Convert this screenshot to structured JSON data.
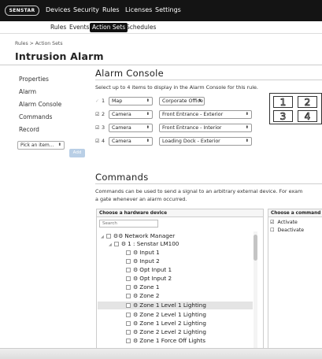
{
  "topnav": {
    "logo": "SENSTAR",
    "items": [
      "Devices",
      "Security",
      "Rules",
      "Licenses",
      "Settings"
    ]
  },
  "subnav": {
    "items": [
      "Rules",
      "Events",
      "Action Sets",
      "Schedules"
    ],
    "active": "Action Sets"
  },
  "header": {
    "breadcrumb": "Rules > Action Sets",
    "title": "Intrusion Alarm"
  },
  "sidebar": {
    "items": [
      "Properties",
      "Alarm",
      "Alarm Console",
      "Commands",
      "Record"
    ],
    "pick_select": "Pick an item...",
    "add_label": "Add"
  },
  "alarm_console": {
    "title": "Alarm Console",
    "description": "Select up to 4 items to display in the Alarm Console for this rule.",
    "slots": [
      {
        "num": "1",
        "checked": false,
        "type": "Map",
        "value": "Corporate Office"
      },
      {
        "num": "2",
        "checked": true,
        "type": "Camera",
        "value": "Front Entrance - Exterior"
      },
      {
        "num": "3",
        "checked": true,
        "type": "Camera",
        "value": "Front Entrance - Interior"
      },
      {
        "num": "4",
        "checked": true,
        "type": "Camera",
        "value": "Loading Dock - Exterior"
      }
    ],
    "grid_labels": [
      "1",
      "2",
      "3",
      "4"
    ]
  },
  "commands": {
    "title": "Commands",
    "description_line1": "Commands can be used to send a signal to an arbitrary external device. For exam",
    "description_line2": "a gate whenever an alarm occurred.",
    "hardware_panel_title": "Choose a hardware device",
    "search_placeholder": "Search",
    "tree": [
      {
        "label": "Network Manager",
        "level": 0,
        "gear": "double"
      },
      {
        "label": "1 : Senstar LM100",
        "level": 1,
        "gear": "single"
      },
      {
        "label": "Input 1",
        "level": 2
      },
      {
        "label": "Input 2",
        "level": 2
      },
      {
        "label": "Opt Input 1",
        "level": 2
      },
      {
        "label": "Opt Input 2",
        "level": 2
      },
      {
        "label": "Zone 1",
        "level": 2
      },
      {
        "label": "Zone 2",
        "level": 2
      },
      {
        "label": "Zone 1 Level 1 Lighting",
        "level": 2,
        "selected": true
      },
      {
        "label": "Zone 2 Level 1 Lighting",
        "level": 2
      },
      {
        "label": "Zone 1 Level 2 Lighting",
        "level": 2
      },
      {
        "label": "Zone 2 Level 2 Lighting",
        "level": 2
      },
      {
        "label": "Zone 1 Force Off Lights",
        "level": 2
      }
    ],
    "command_panel_title": "Choose a command",
    "command_options": [
      {
        "label": "Activate",
        "checked": true
      },
      {
        "label": "Deactivate",
        "checked": false
      }
    ]
  },
  "colors": {
    "topbar": "#141414",
    "add_button": "#b9cfe6",
    "selected_row": "#e4e4e4"
  }
}
